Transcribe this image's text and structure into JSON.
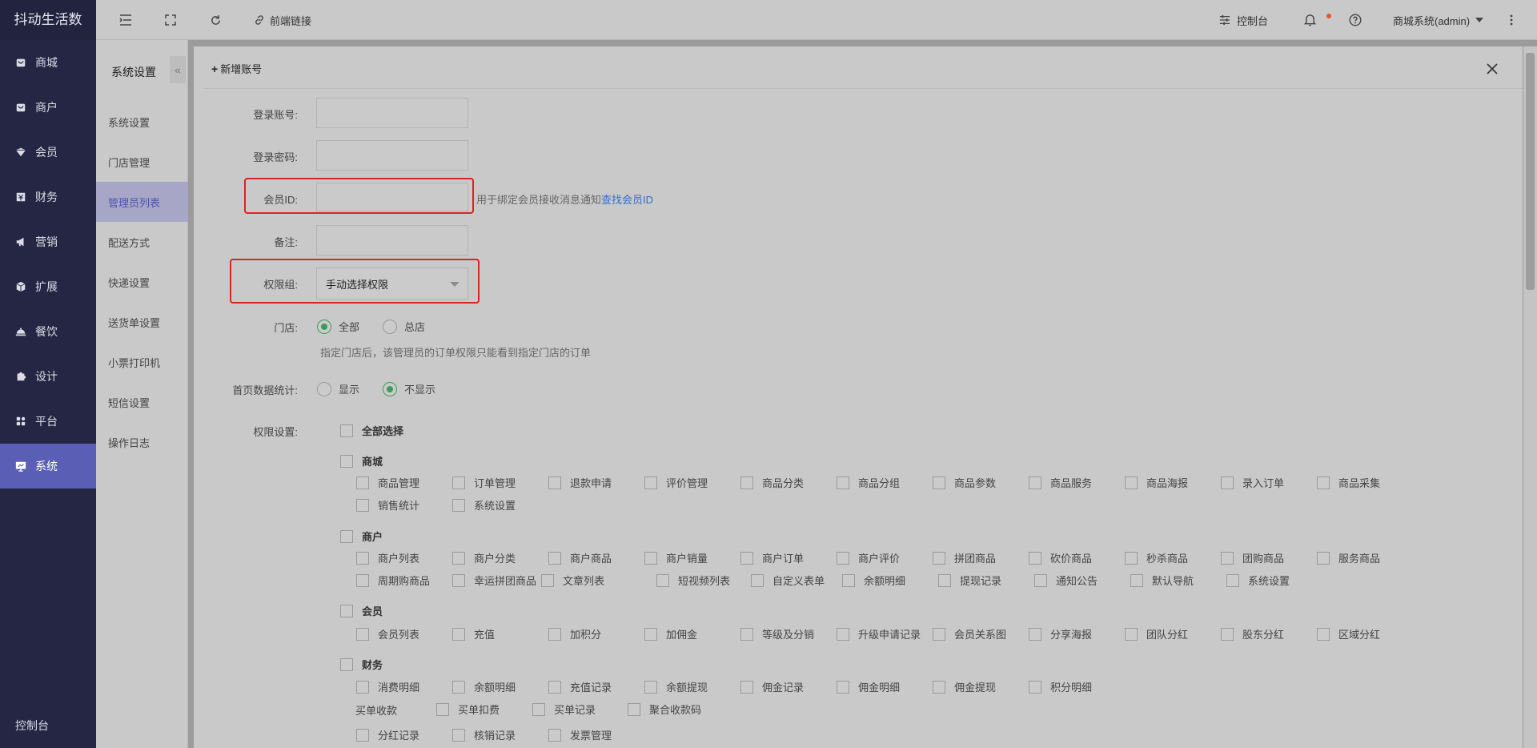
{
  "app": {
    "logo": "抖动生活数"
  },
  "sidebar": {
    "items": [
      {
        "label": "商城",
        "icon": "shop-icon"
      },
      {
        "label": "商户",
        "icon": "merchant-icon"
      },
      {
        "label": "会员",
        "icon": "member-icon"
      },
      {
        "label": "财务",
        "icon": "finance-icon"
      },
      {
        "label": "营销",
        "icon": "megaphone-icon"
      },
      {
        "label": "扩展",
        "icon": "cube-icon"
      },
      {
        "label": "餐饮",
        "icon": "dining-icon"
      },
      {
        "label": "设计",
        "icon": "puzzle-icon"
      },
      {
        "label": "平台",
        "icon": "grid-icon"
      },
      {
        "label": "系统",
        "icon": "monitor-icon",
        "active": true
      }
    ],
    "bottom": {
      "label": "控制台",
      "icon": "gear-icon"
    }
  },
  "topbar": {
    "frontend_link": "前端链接",
    "console": "控制台",
    "user": "商城系统(admin)"
  },
  "subnav": {
    "title": "系统设置",
    "collapse": "«",
    "items": [
      "系统设置",
      "门店管理",
      "管理员列表",
      "配送方式",
      "快递设置",
      "送货单设置",
      "小票打印机",
      "短信设置",
      "操作日志"
    ],
    "active_index": 2
  },
  "form": {
    "title": "新增账号",
    "login_account": {
      "label": "登录账号:",
      "value": ""
    },
    "login_password": {
      "label": "登录密码:",
      "value": ""
    },
    "member_id": {
      "label": "会员ID:",
      "value": "",
      "hint": "用于绑定会员接收消息通知",
      "hint_link": "查找会员ID"
    },
    "remark": {
      "label": "备注:",
      "value": ""
    },
    "permission_group": {
      "label": "权限组:",
      "value": "手动选择权限"
    },
    "store": {
      "label": "门店:",
      "options": [
        "全部",
        "总店"
      ],
      "selected": "全部",
      "hint": "指定门店后，该管理员的订单权限只能看到指定门店的订单"
    },
    "home_stats": {
      "label": "首页数据统计:",
      "options": [
        "显示",
        "不显示"
      ],
      "selected": "不显示"
    },
    "permissions": {
      "label": "权限设置:",
      "select_all": "全部选择",
      "groups": [
        {
          "name": "商城",
          "rows": [
            [
              "商品管理",
              "订单管理",
              "退款申请",
              "评价管理",
              "商品分类",
              "商品分组",
              "商品参数",
              "商品服务",
              "商品海报",
              "录入订单",
              "商品采集"
            ],
            [
              "销售统计",
              "系统设置"
            ]
          ]
        },
        {
          "name": "商户",
          "rows": [
            [
              "商户列表",
              "商户分类",
              "商户商品",
              "商户销量",
              "商户订单",
              "商户评价",
              "拼团商品",
              "砍价商品",
              "秒杀商品",
              "团购商品",
              "服务商品"
            ],
            [
              "周期购商品",
              "幸运拼团商品",
              "文章列表",
              "短视频列表",
              "自定义表单",
              "余额明细",
              "提现记录",
              "通知公告",
              "默认导航",
              "系统设置"
            ]
          ]
        },
        {
          "name": "会员",
          "rows": [
            [
              "会员列表",
              "充值",
              "加积分",
              "加佣金",
              "等级及分销",
              "升级申请记录",
              "会员关系图",
              "分享海报",
              "团队分红",
              "股东分红",
              "区域分红"
            ]
          ]
        },
        {
          "name": "财务",
          "rows": [
            [
              "消费明细",
              "余额明细",
              "充值记录",
              "余额提现",
              "佣金记录",
              "佣金明细",
              "佣金提现",
              "积分明细"
            ],
            [
              "买单扣费",
              "买单记录",
              "聚合收款码"
            ],
            [
              "分红记录",
              "核销记录",
              "发票管理"
            ]
          ],
          "subheading": "买单收款"
        }
      ]
    }
  },
  "colors": {
    "sidebar_bg": "#252644",
    "active": "#5a5fb5",
    "highlight": "#e0221f",
    "radio_on": "#3e9b59",
    "link": "#2d6fd2"
  }
}
